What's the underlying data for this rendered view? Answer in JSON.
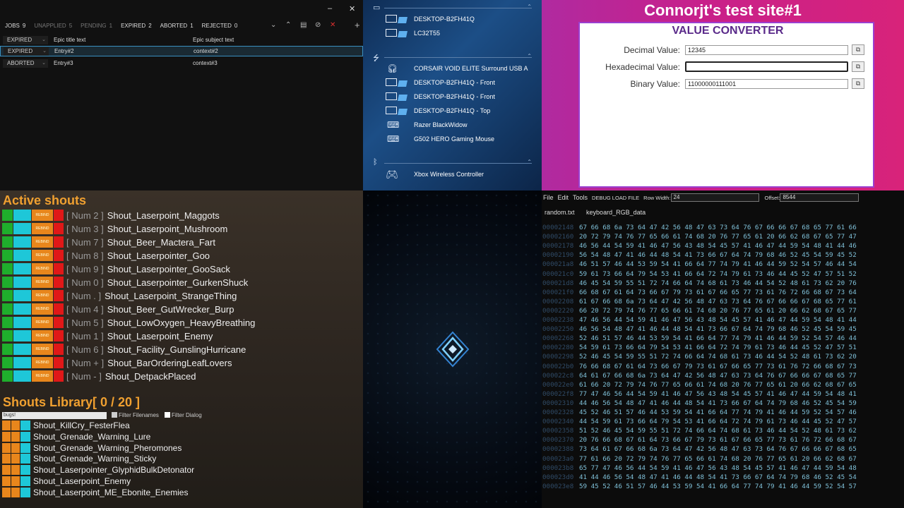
{
  "jobs": {
    "stats": [
      {
        "label": "JOBS",
        "value": "9",
        "dim": false
      },
      {
        "label": "UNAPPLIED",
        "value": "5",
        "dim": true
      },
      {
        "label": "PENDING",
        "value": "1",
        "dim": true
      },
      {
        "label": "EXPIRED",
        "value": "2",
        "dim": false
      },
      {
        "label": "ABORTED",
        "value": "1",
        "dim": false
      },
      {
        "label": "REJECTED",
        "value": "0",
        "dim": false
      }
    ],
    "col_title": "Epic title text",
    "col_subject": "Epic subject text",
    "minimize": "–",
    "close": "✕",
    "rows": [
      {
        "status": "EXPIRED",
        "title": "Entry#2",
        "subject": "context#2",
        "selected": true
      },
      {
        "status": "ABORTED",
        "title": "Entry#3",
        "subject": "context#3",
        "selected": false
      }
    ],
    "header_status": "EXPIRED"
  },
  "devices": {
    "section1": [
      "DESKTOP-B2FH41Q",
      "LC32T55"
    ],
    "section2": [
      "CORSAIR VOID ELITE Surround USB A",
      "DESKTOP-B2FH41Q - Front",
      "DESKTOP-B2FH41Q - Front",
      "DESKTOP-B2FH41Q - Top",
      "Razer BlackWidow",
      "G502 HERO Gaming Mouse"
    ],
    "section3": [
      "Xbox Wireless Controller"
    ]
  },
  "converter": {
    "site_title": "Connorjt's test site#1",
    "panel_title": "VALUE CONVERTER",
    "decimal_label": "Decimal Value:",
    "decimal_value": "12345",
    "hex_label": "Hexadecimal Value:",
    "hex_value": "",
    "binary_label": "Binary Value:",
    "binary_value": "11000000111001"
  },
  "shouts": {
    "active_title": "Active shouts",
    "rebind": "REBIND",
    "active": [
      {
        "key": "[ Num 2 ]",
        "name": "Shout_Laserpoint_Maggots"
      },
      {
        "key": "[ Num 3 ]",
        "name": "Shout_Laserpoint_Mushroom"
      },
      {
        "key": "[ Num 7 ]",
        "name": "Shout_Beer_Mactera_Fart"
      },
      {
        "key": "[ Num 8 ]",
        "name": "Shout_Laserpointer_Goo"
      },
      {
        "key": "[ Num 9 ]",
        "name": "Shout_Laserpointer_GooSack"
      },
      {
        "key": "[ Num 0 ]",
        "name": "Shout_Laserpointer_GurkenShuck"
      },
      {
        "key": "[ Num . ]",
        "name": "Shout_Laserpoint_StrangeThing"
      },
      {
        "key": "[ Num 4 ]",
        "name": "Shout_Beer_GutWrecker_Burp"
      },
      {
        "key": "[ Num 5 ]",
        "name": "Shout_LowOxygen_HeavyBreathing"
      },
      {
        "key": "[ Num 1 ]",
        "name": "Shout_Laserpoint_Enemy"
      },
      {
        "key": "[ Num 6 ]",
        "name": "Shout_Facility_GunslingHurricane"
      },
      {
        "key": "[ Num + ]",
        "name": "Shout_BarOrderingLeafLovers"
      },
      {
        "key": "[ Num - ]",
        "name": "Shout_DetpackPlaced"
      }
    ],
    "library_title": "Shouts Library[ 0 / 20 ]",
    "search_value": "bugs!",
    "filter_filenames": "Filter Filenames",
    "filter_dialog": "Filter Dialog",
    "library": [
      "Shout_KillCry_FesterFlea",
      "Shout_Grenade_Warning_Lure",
      "Shout_Grenade_Warning_Pheromones",
      "Shout_Grenade_Warning_Sticky",
      "Shout_Laserpointer_GlyphidBulkDetonator",
      "Shout_Laserpoint_Enemy",
      "Shout_Laserpoint_ME_Ebonite_Enemies"
    ]
  },
  "hexview": {
    "menu": [
      "File",
      "Edit",
      "Tools",
      "DEBUG LOAD FILE"
    ],
    "row_width_label": "Row Width:",
    "row_width": "24",
    "offset_label": "Offset:",
    "offset": "8544",
    "tabs": [
      "random.txt",
      "keyboard_RGB_data"
    ],
    "rows": [
      {
        "addr": "00002148",
        "hex": "67 66 68 6a 73 64 47 42 56 48 47 63 73 64 76 67 66 66 67 68 65 77 61 66"
      },
      {
        "addr": "00002160",
        "hex": "20 72 79 74 76 77 65 66 61 74 68 20 76 77 65 61 20 66 62 68 67 65 77 47"
      },
      {
        "addr": "00002178",
        "hex": "46 56 44 54 59 41 46 47 56 43 48 54 45 57 41 46 47 44 59 54 48 41 44 46"
      },
      {
        "addr": "00002190",
        "hex": "56 54 48 47 41 46 44 48 54 41 73 66 67 64 74 79 68 46 52 45 54 59 45 52"
      },
      {
        "addr": "000021a8",
        "hex": "46 51 57 46 44 53 59 54 41 66 64 77 74 79 41 46 44 59 52 54 57 46 44 54"
      },
      {
        "addr": "000021c0",
        "hex": "59 61 73 66 64 79 54 53 41 66 64 72 74 79 61 73 46 44 45 52 47 57 51 52"
      },
      {
        "addr": "000021d8",
        "hex": "46 45 54 59 55 51 72 74 66 64 74 68 61 73 46 44 54 52 48 61 73 62 20 76"
      },
      {
        "addr": "000021f0",
        "hex": "66 68 67 61 64 73 66 67 79 73 61 67 66 65 77 73 61 76 72 66 68 67 73 64"
      },
      {
        "addr": "00002208",
        "hex": "61 67 66 68 6a 73 64 47 42 56 48 47 63 73 64 76 67 66 66 67 68 65 77 61"
      },
      {
        "addr": "00002220",
        "hex": "66 20 72 79 74 76 77 65 66 61 74 68 20 76 77 65 61 20 66 62 68 67 65 77"
      },
      {
        "addr": "00002238",
        "hex": "47 46 56 44 54 59 41 46 47 56 43 48 54 45 57 41 46 47 44 59 54 48 41 44"
      },
      {
        "addr": "00002250",
        "hex": "46 56 54 48 47 41 46 44 48 54 41 73 66 67 64 74 79 68 46 52 45 54 59 45"
      },
      {
        "addr": "00002268",
        "hex": "52 46 51 57 46 44 53 59 54 41 66 64 77 74 79 41 46 44 59 52 54 57 46 44"
      },
      {
        "addr": "00002280",
        "hex": "54 59 61 73 66 64 79 54 53 41 66 64 72 74 79 61 73 46 44 45 52 47 57 51"
      },
      {
        "addr": "00002298",
        "hex": "52 46 45 54 59 55 51 72 74 66 64 74 68 61 73 46 44 54 52 48 61 73 62 20"
      },
      {
        "addr": "000022b0",
        "hex": "76 66 68 67 61 64 73 66 67 79 73 61 67 66 65 77 73 61 76 72 66 68 67 73"
      },
      {
        "addr": "000022c8",
        "hex": "64 61 67 66 68 6a 73 64 47 42 56 48 47 63 73 64 76 67 66 66 67 68 65 77"
      },
      {
        "addr": "000022e0",
        "hex": "61 66 20 72 79 74 76 77 65 66 61 74 68 20 76 77 65 61 20 66 62 68 67 65"
      },
      {
        "addr": "000022f8",
        "hex": "77 47 46 56 44 54 59 41 46 47 56 43 48 54 45 57 41 46 47 44 59 54 48 41"
      },
      {
        "addr": "00002310",
        "hex": "44 46 56 54 48 47 41 46 44 48 54 41 73 66 67 64 74 79 68 46 52 45 54 59"
      },
      {
        "addr": "00002328",
        "hex": "45 52 46 51 57 46 44 53 59 54 41 66 64 77 74 79 41 46 44 59 52 54 57 46"
      },
      {
        "addr": "00002340",
        "hex": "44 54 59 61 73 66 64 79 54 53 41 66 64 72 74 79 61 73 46 44 45 52 47 57"
      },
      {
        "addr": "00002358",
        "hex": "51 52 46 45 54 59 55 51 72 74 66 64 74 68 61 73 46 44 54 52 48 61 73 62"
      },
      {
        "addr": "00002370",
        "hex": "20 76 66 68 67 61 64 73 66 67 79 73 61 67 66 65 77 73 61 76 72 66 68 67"
      },
      {
        "addr": "00002388",
        "hex": "73 64 61 67 66 68 6a 73 64 47 42 56 48 47 63 73 64 76 67 66 66 67 68 65"
      },
      {
        "addr": "000023a0",
        "hex": "77 61 66 20 72 79 74 76 77 65 66 61 74 68 20 76 77 65 61 20 66 62 68 67"
      },
      {
        "addr": "000023b8",
        "hex": "65 77 47 46 56 44 54 59 41 46 47 56 43 48 54 45 57 41 46 47 44 59 54 48"
      },
      {
        "addr": "000023d0",
        "hex": "41 44 46 56 54 48 47 41 46 44 48 54 41 73 66 67 64 74 79 68 46 52 45 54"
      },
      {
        "addr": "000023e8",
        "hex": "59 45 52 46 51 57 46 44 53 59 54 41 66 64 77 74 79 41 46 44 59 52 54 57"
      }
    ]
  }
}
